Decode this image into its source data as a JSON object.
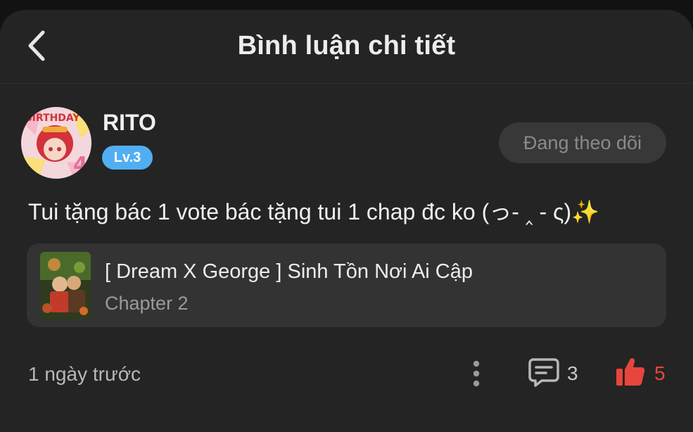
{
  "header": {
    "title": "Bình luận chi tiết",
    "back_icon": "chevron-left-icon"
  },
  "comment": {
    "author": {
      "name": "RITO",
      "level": "Lv.3",
      "avatar_text": "BIRTHDAY",
      "avatar_number": "4"
    },
    "follow_label": "Đang theo dõi",
    "text": "Tui tặng bác 1 vote bác tặng tui 1 chap đc ko (っ- ‸ - ς)✨",
    "story": {
      "title": "[ Dream X George ] Sinh Tồn Nơi Ai Cập",
      "chapter": "Chapter 2"
    },
    "timestamp": "1 ngày trước",
    "reply_count": "3",
    "like_count": "5"
  },
  "colors": {
    "background": "#242424",
    "card": "#333333",
    "level_badge": "#52aef2",
    "like": "#e8453c"
  }
}
